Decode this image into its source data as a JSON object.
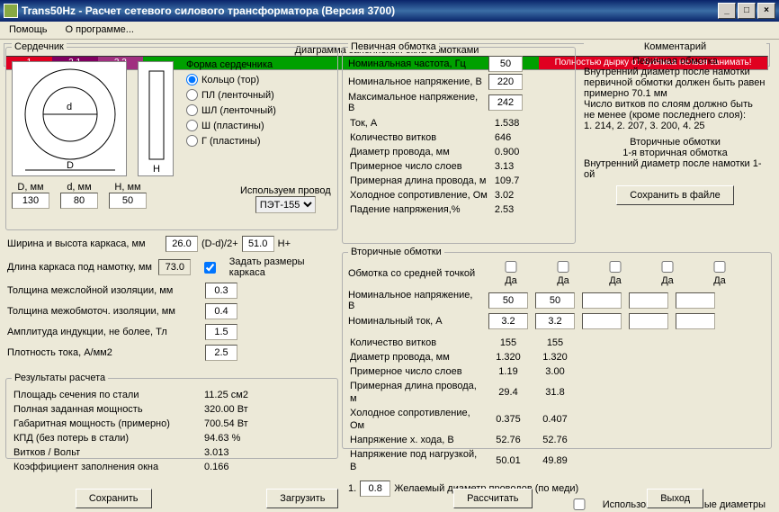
{
  "window": {
    "title": "Trans50Hz - Расчет сетевого силового трансформатора (Версия 3700)"
  },
  "menu": {
    "help": "Помощь",
    "about": "О программе..."
  },
  "core": {
    "legend": "Сердечник",
    "formLabel": "Форма сердечника",
    "shapes": {
      "ring": "Кольцо (тор)",
      "pl": "ПЛ (ленточный)",
      "shl": "ШЛ (ленточный)",
      "sh": "Ш (пластины)",
      "g": "Г (пластины)"
    },
    "dims": {
      "D_label": "D, мм",
      "D": "130",
      "d_label": "d, мм",
      "d": "80",
      "H_label": "H, мм",
      "H": "50"
    },
    "wireLabel": "Используем провод",
    "wire": "ПЭТ-155"
  },
  "leftParams": {
    "frameWH": {
      "label": "Ширина и высота каркаса, мм",
      "v1": "26.0",
      "mid": "(D-d)/2+",
      "v2": "51.0",
      "suffix": "H+"
    },
    "frameLen": {
      "label": "Длина каркаса под намотку, мм",
      "v": "73.0"
    },
    "setSizes": "Задать размеры каркаса",
    "interlayer": {
      "label": "Толщина межслойной изоляции, мм",
      "v": "0.3"
    },
    "intercoil": {
      "label": "Толщина межобмоточ. изоляции, мм",
      "v": "0.4"
    },
    "induction": {
      "label": "Амплитуда индукции, не более, Тл",
      "v": "1.5"
    },
    "density": {
      "label": "Плотность тока, А/мм2",
      "v": "2.5"
    }
  },
  "primary": {
    "legend": "Певичная обмотка",
    "freq": {
      "label": "Номинальная частота, Гц",
      "v": "50"
    },
    "voltNom": {
      "label": "Номинальное напряжение, В",
      "v": "220"
    },
    "voltMax": {
      "label": "Максимальное напряжение, В",
      "v": "242"
    },
    "calc": {
      "current": {
        "label": "Ток, A",
        "v": "1.538"
      },
      "turns": {
        "label": "Количество витков",
        "v": "646"
      },
      "wireD": {
        "label": "Диаметр провода, мм",
        "v": "0.900"
      },
      "layers": {
        "label": "Примерное число слоев",
        "v": "3.13"
      },
      "wireLen": {
        "label": "Примерная длина провода, м",
        "v": "109.7"
      },
      "coldR": {
        "label": "Холодное сопротивление, Ом",
        "v": "3.02"
      },
      "vdrop": {
        "label": "Падение напряжения,%",
        "v": "2.53"
      }
    }
  },
  "comment": {
    "legend": "Комментарий",
    "t1": "Певичная обмотка",
    "l1": "Внутренний диаметр после намотки первичной обмотки должен быть равен примерно 70.1 мм",
    "l2": "Число витков по слоям должно быть не менее (кроме последнего слоя):",
    "l3": "1. 214,  2. 207,  3. 200,  4. 25",
    "t2": "Вторичные обмотки",
    "l4": "1-я вторичная обмотка",
    "l5": "Внутренний диаметр после намотки 1-ой",
    "saveBtn": "Сохранить в файле"
  },
  "secondary": {
    "legend": "Вторичные обмотки",
    "centerTap": "Обмотка со средней точкой",
    "yes": "Да",
    "voltNom": {
      "label": "Номинальное напряжение, В",
      "v1": "50",
      "v2": "50"
    },
    "curNom": {
      "label": "Номинальный ток, А",
      "v1": "3.2",
      "v2": "3.2"
    },
    "rows": {
      "turns": {
        "label": "Количество витков",
        "c1": "155",
        "c2": "155"
      },
      "wireD": {
        "label": "Диаметр провода, мм",
        "c1": "1.320",
        "c2": "1.320"
      },
      "layers": {
        "label": "Примерное число слоев",
        "c1": "1.19",
        "c2": "3.00"
      },
      "wireLen": {
        "label": "Примерная длина провода, м",
        "c1": "29.4",
        "c2": "31.8"
      },
      "coldR": {
        "label": "Холодное сопротивление, Ом",
        "c1": "0.375",
        "c2": "0.407"
      },
      "vIdle": {
        "label": "Напряжение х. хода, В",
        "c1": "52.76",
        "c2": "52.76"
      },
      "vLoad": {
        "label": "Напряжение под нагрузкой, В",
        "c1": "50.01",
        "c2": "49.89"
      }
    },
    "desired": {
      "num": "1.",
      "v": "0.8",
      "label": "Желаемый диаметр проводов (по меди)"
    },
    "useDesired": "Использовать желаемые диаметры"
  },
  "results": {
    "legend": "Результаты расчета",
    "steelArea": {
      "label": "Площадь сечения по стали",
      "v": "11.25 см2"
    },
    "fullPower": {
      "label": "Полная заданная мощность",
      "v": "320.00 Вт"
    },
    "gabPower": {
      "label": "Габаритная мощность (примерно)",
      "v": "700.54 Вт"
    },
    "kpd": {
      "label": "КПД (без потерь в стали)",
      "v": "94.63 %"
    },
    "tpv": {
      "label": "Витков / Вольт",
      "v": "3.013"
    },
    "fill": {
      "label": "Коэффициент заполнения окна",
      "v": "0.166"
    }
  },
  "diagram": {
    "legend": "Диаграмма заполнения окна обмотками",
    "segs": [
      "1",
      "2.1",
      "2.2"
    ],
    "warn": "Полностью дырку от бублика нельзя занимать!"
  },
  "buttons": {
    "save": "Сохранить",
    "load": "Загрузить",
    "calc": "Рассчитать",
    "exit": "Выход"
  }
}
